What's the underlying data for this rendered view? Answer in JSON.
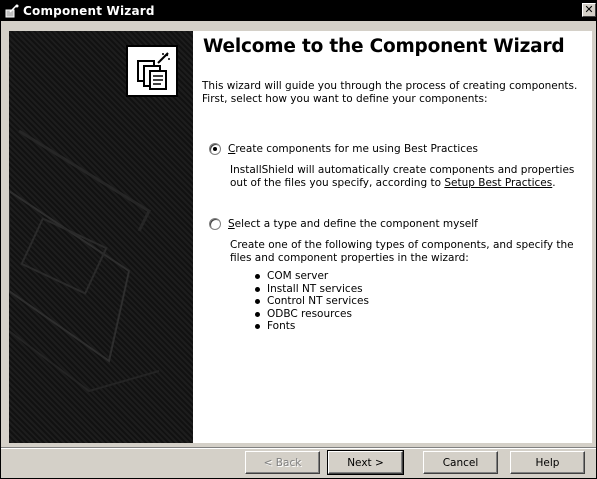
{
  "window": {
    "title": "Component Wizard",
    "close_glyph": "✕"
  },
  "content": {
    "heading": "Welcome to the Component Wizard",
    "intro": "This wizard will guide you through the process of creating components. First, select how you want to define your components:",
    "option_best_practices": {
      "accel": "C",
      "label_rest": "reate components for me using Best Practices",
      "selected": true,
      "desc_prefix": "InstallShield will automatically create components and properties out of the files you specify, according to ",
      "desc_link": "Setup Best Practices",
      "desc_suffix": "."
    },
    "option_custom": {
      "accel": "S",
      "label_rest": "elect a type and define the component myself",
      "selected": false,
      "desc": "Create one of the following types of components, and specify the files and component properties in the wizard:",
      "types": [
        "COM server",
        "Install NT services",
        "Control NT services",
        "ODBC resources",
        "Fonts"
      ]
    }
  },
  "buttons": {
    "back": "< Back",
    "next": "Next >",
    "cancel": "Cancel",
    "help": "Help"
  },
  "icons": {
    "title": "wizard-wand-icon",
    "logo": "documents-wizard-icon"
  }
}
